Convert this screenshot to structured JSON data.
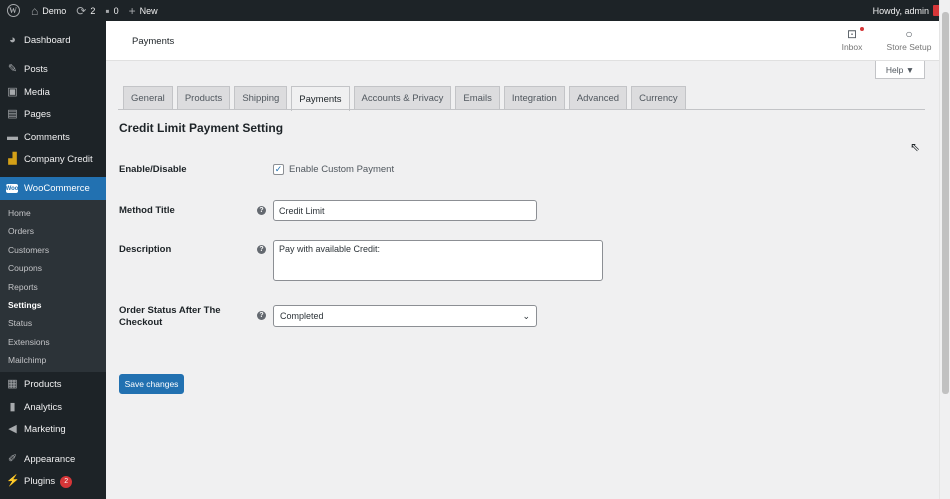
{
  "admin_bar": {
    "site_name": "Demo",
    "updates_count": "2",
    "comments_count": "0",
    "new_label": "New",
    "howdy": "Howdy, admin",
    "icons": {
      "wp": "wordpress-logo-icon",
      "home": "home-icon",
      "updates": "refresh-icon",
      "comments": "comment-bubble-icon",
      "new": "plus-icon"
    }
  },
  "sidebar": {
    "top_items": [
      {
        "label": "Dashboard",
        "icon": "dashboard-icon"
      },
      {
        "label": "Posts",
        "icon": "pin-icon"
      },
      {
        "label": "Media",
        "icon": "media-icon"
      },
      {
        "label": "Pages",
        "icon": "page-icon"
      },
      {
        "label": "Comments",
        "icon": "comment-icon"
      },
      {
        "label": "Company Credit",
        "icon": "bar-chart-icon"
      }
    ],
    "current": {
      "label": "WooCommerce",
      "icon": "woo-icon",
      "badge_text": "Woo"
    },
    "submenu": [
      "Home",
      "Orders",
      "Customers",
      "Coupons",
      "Reports",
      "Settings",
      "Status",
      "Extensions",
      "Mailchimp"
    ],
    "active_submenu": "Settings",
    "bottom_items": [
      {
        "label": "Products",
        "icon": "archive-icon"
      },
      {
        "label": "Analytics",
        "icon": "analytics-icon"
      },
      {
        "label": "Marketing",
        "icon": "megaphone-icon"
      },
      {
        "label": "Appearance",
        "icon": "brush-icon"
      },
      {
        "label": "Plugins",
        "icon": "plug-icon",
        "badge": "2"
      }
    ],
    "bg_color": "#1d2327",
    "accent_color": "#2271b1"
  },
  "header": {
    "title": "Payments",
    "inbox_label": "Inbox",
    "store_setup_label": "Store Setup"
  },
  "help": {
    "label": "Help ▼"
  },
  "tabs": [
    {
      "label": "General",
      "active": false
    },
    {
      "label": "Products",
      "active": false
    },
    {
      "label": "Shipping",
      "active": false
    },
    {
      "label": "Payments",
      "active": true
    },
    {
      "label": "Accounts & Privacy",
      "active": false
    },
    {
      "label": "Emails",
      "active": false
    },
    {
      "label": "Integration",
      "active": false
    },
    {
      "label": "Advanced",
      "active": false
    },
    {
      "label": "Currency",
      "active": false
    }
  ],
  "settings": {
    "heading": "Credit Limit Payment Setting",
    "enable": {
      "label": "Enable/Disable",
      "checkbox_label": "Enable Custom Payment",
      "checked": true
    },
    "method_title": {
      "label": "Method Title",
      "value": "Credit Limit"
    },
    "description": {
      "label": "Description",
      "value": "Pay with available Credit:"
    },
    "order_status": {
      "label": "Order Status After The Checkout",
      "value": "Completed"
    },
    "tip_glyph": "?",
    "save_label": "Save changes"
  }
}
